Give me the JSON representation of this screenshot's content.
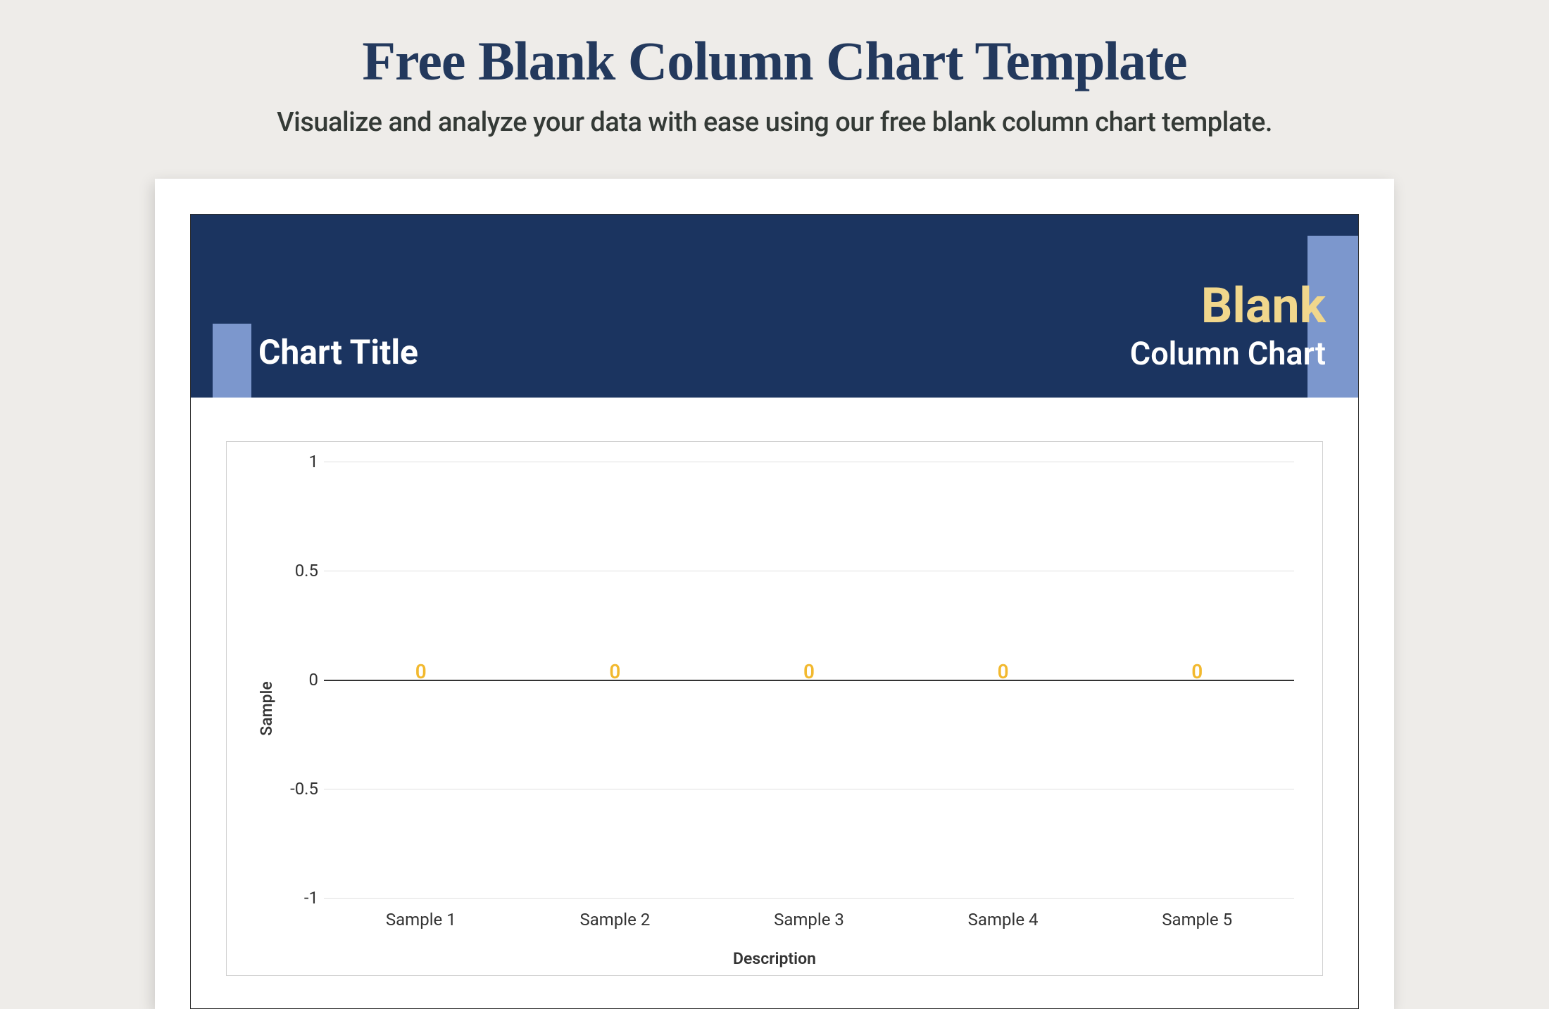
{
  "page": {
    "title": "Free Blank Column Chart Template",
    "subtitle": "Visualize and analyze your data with ease using our free blank column chart template."
  },
  "template_header": {
    "chart_title_label": "Chart Title",
    "blank_label": "Blank",
    "type_label": "Column Chart"
  },
  "chart_data": {
    "type": "bar",
    "categories": [
      "Sample 1",
      "Sample 2",
      "Sample 3",
      "Sample 4",
      "Sample 5"
    ],
    "values": [
      0,
      0,
      0,
      0,
      0
    ],
    "data_labels": [
      "0",
      "0",
      "0",
      "0",
      "0"
    ],
    "title": "Chart Title",
    "xlabel": "Description",
    "ylabel": "Sample",
    "ylim": [
      -1,
      1
    ],
    "yticks": [
      1,
      0.5,
      0,
      -0.5,
      -1
    ],
    "ytick_labels": [
      "1",
      "0.5",
      "0",
      "-0.5",
      "-1"
    ]
  }
}
